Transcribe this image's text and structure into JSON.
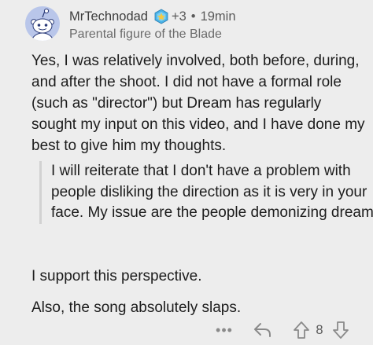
{
  "comment": {
    "username": "MrTechnodad",
    "award_count": "+3",
    "separator": "•",
    "time": "19min",
    "flair": "Parental figure of the Blade",
    "paragraph_1": "Yes, I was relatively involved, both before, during, and after the shoot. I did not have a formal role (such as \"director\") but Dream has regularly sought my input on this video, and I have done my best to give him my thoughts.",
    "quote": "I will reiterate that I don't have a problem with people disliking the direction as it is very in your face. My issue are the people demonizing dream.",
    "paragraph_2": "I support this perspective.",
    "paragraph_3": "Also, the song absolutely slaps."
  },
  "actions": {
    "more_label": "•••",
    "vote_count": "8"
  },
  "icons": {
    "avatar": "reddit-snoo-avatar",
    "award": "award-icon",
    "reply": "reply-icon",
    "upvote": "upvote-icon",
    "downvote": "downvote-icon"
  },
  "colors": {
    "background": "#ededed",
    "avatar_bg": "#b9c6ea",
    "award_blue": "#4ab3e8",
    "award_gold": "#f5c944",
    "icon_gray": "#8a8a8a"
  }
}
